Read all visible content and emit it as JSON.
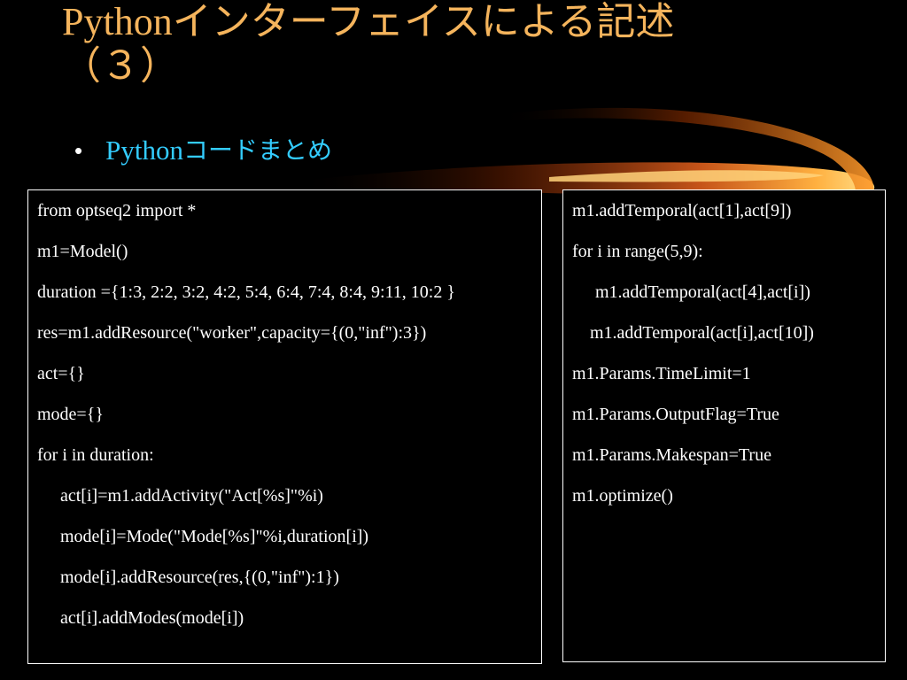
{
  "slide": {
    "title_latin": "Python",
    "title_jp": "インターフェイスによる記述",
    "title_line2": "（３）",
    "bullet_latin": "Python",
    "bullet_jp": "コードまとめ",
    "bullet_marker": "•"
  },
  "colors": {
    "title": "#f5b45c",
    "bullet": "#33ccff",
    "code_text": "#ffffff",
    "background": "#000000"
  },
  "code_left": {
    "lines": [
      "from optseq2 import *",
      "m1=Model()",
      "duration ={1:3, 2:2, 3:2, 4:2, 5:4, 6:4, 7:4, 8:4, 9:11, 10:2 }",
      "res=m1.addResource(\"worker\",capacity={(0,\"inf\"):3})",
      "act={}",
      "mode={}",
      "for i in duration:",
      "act[i]=m1.addActivity(\"Act[%s]\"%i)",
      "mode[i]=Mode(\"Mode[%s]\"%i,duration[i])",
      "mode[i].addResource(res,{(0,\"inf\"):1})",
      "act[i].addModes(mode[i])"
    ]
  },
  "code_right": {
    "lines": [
      "m1.addTemporal(act[1],act[9])",
      "for i in range(5,9):",
      "m1.addTemporal(act[4],act[i])",
      "m1.addTemporal(act[i],act[10])",
      "m1.Params.TimeLimit=1",
      "m1.Params.OutputFlag=True",
      "m1.Params.Makespan=True",
      "m1.optimize()"
    ]
  }
}
